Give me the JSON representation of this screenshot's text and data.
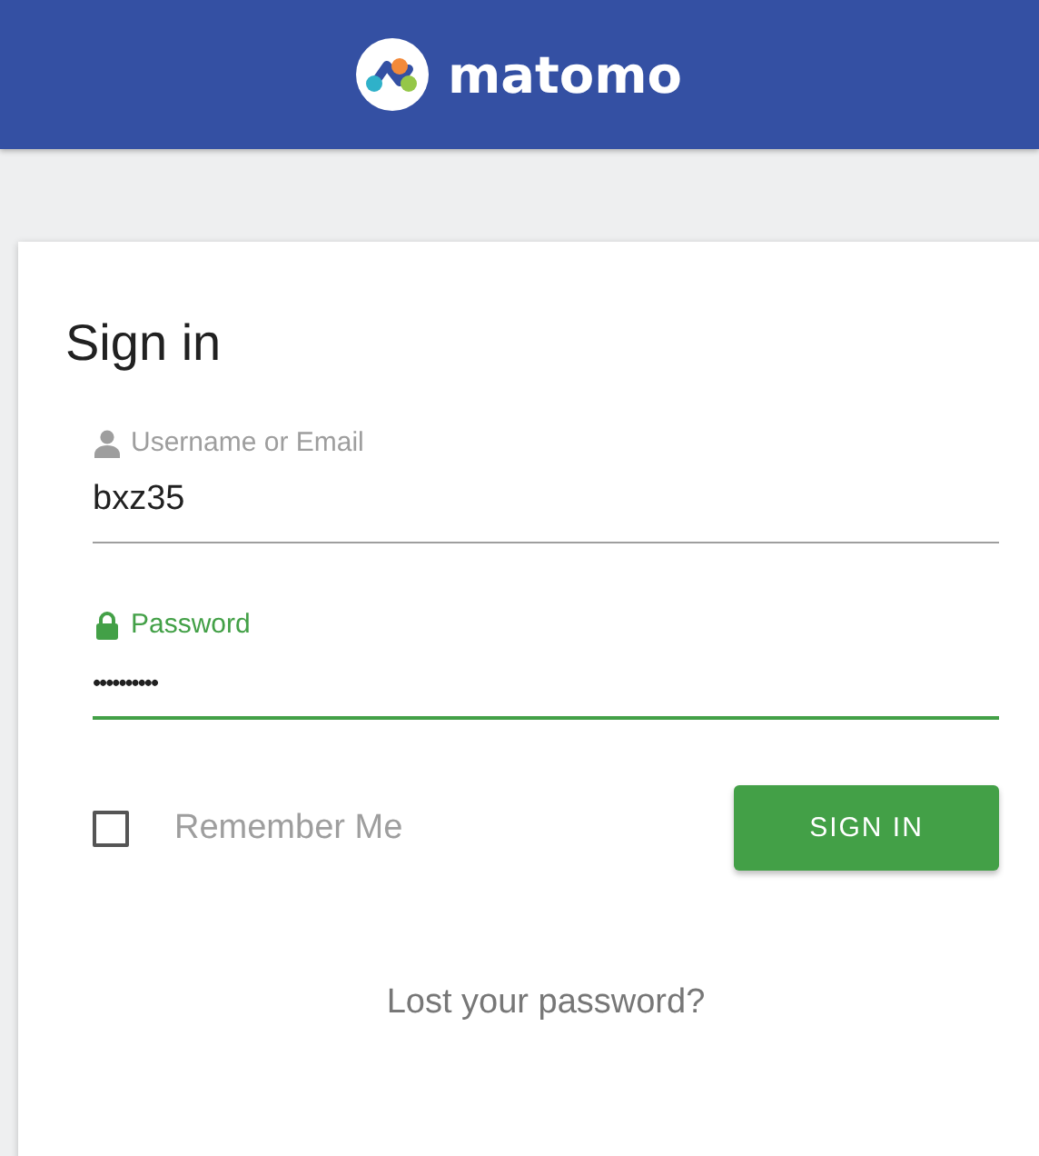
{
  "header": {
    "logo_text": "matomo"
  },
  "form": {
    "title": "Sign in",
    "fields": [
      {
        "kind": "user",
        "label": "Username or Email",
        "value": "bxz35",
        "focused": false
      },
      {
        "kind": "lock",
        "label": "Password",
        "value": "••••••••••",
        "focused": true
      }
    ],
    "remember": {
      "label": "Remember Me",
      "checked": false
    },
    "submit": "SIGN IN",
    "lost_password": "Lost your password?"
  }
}
